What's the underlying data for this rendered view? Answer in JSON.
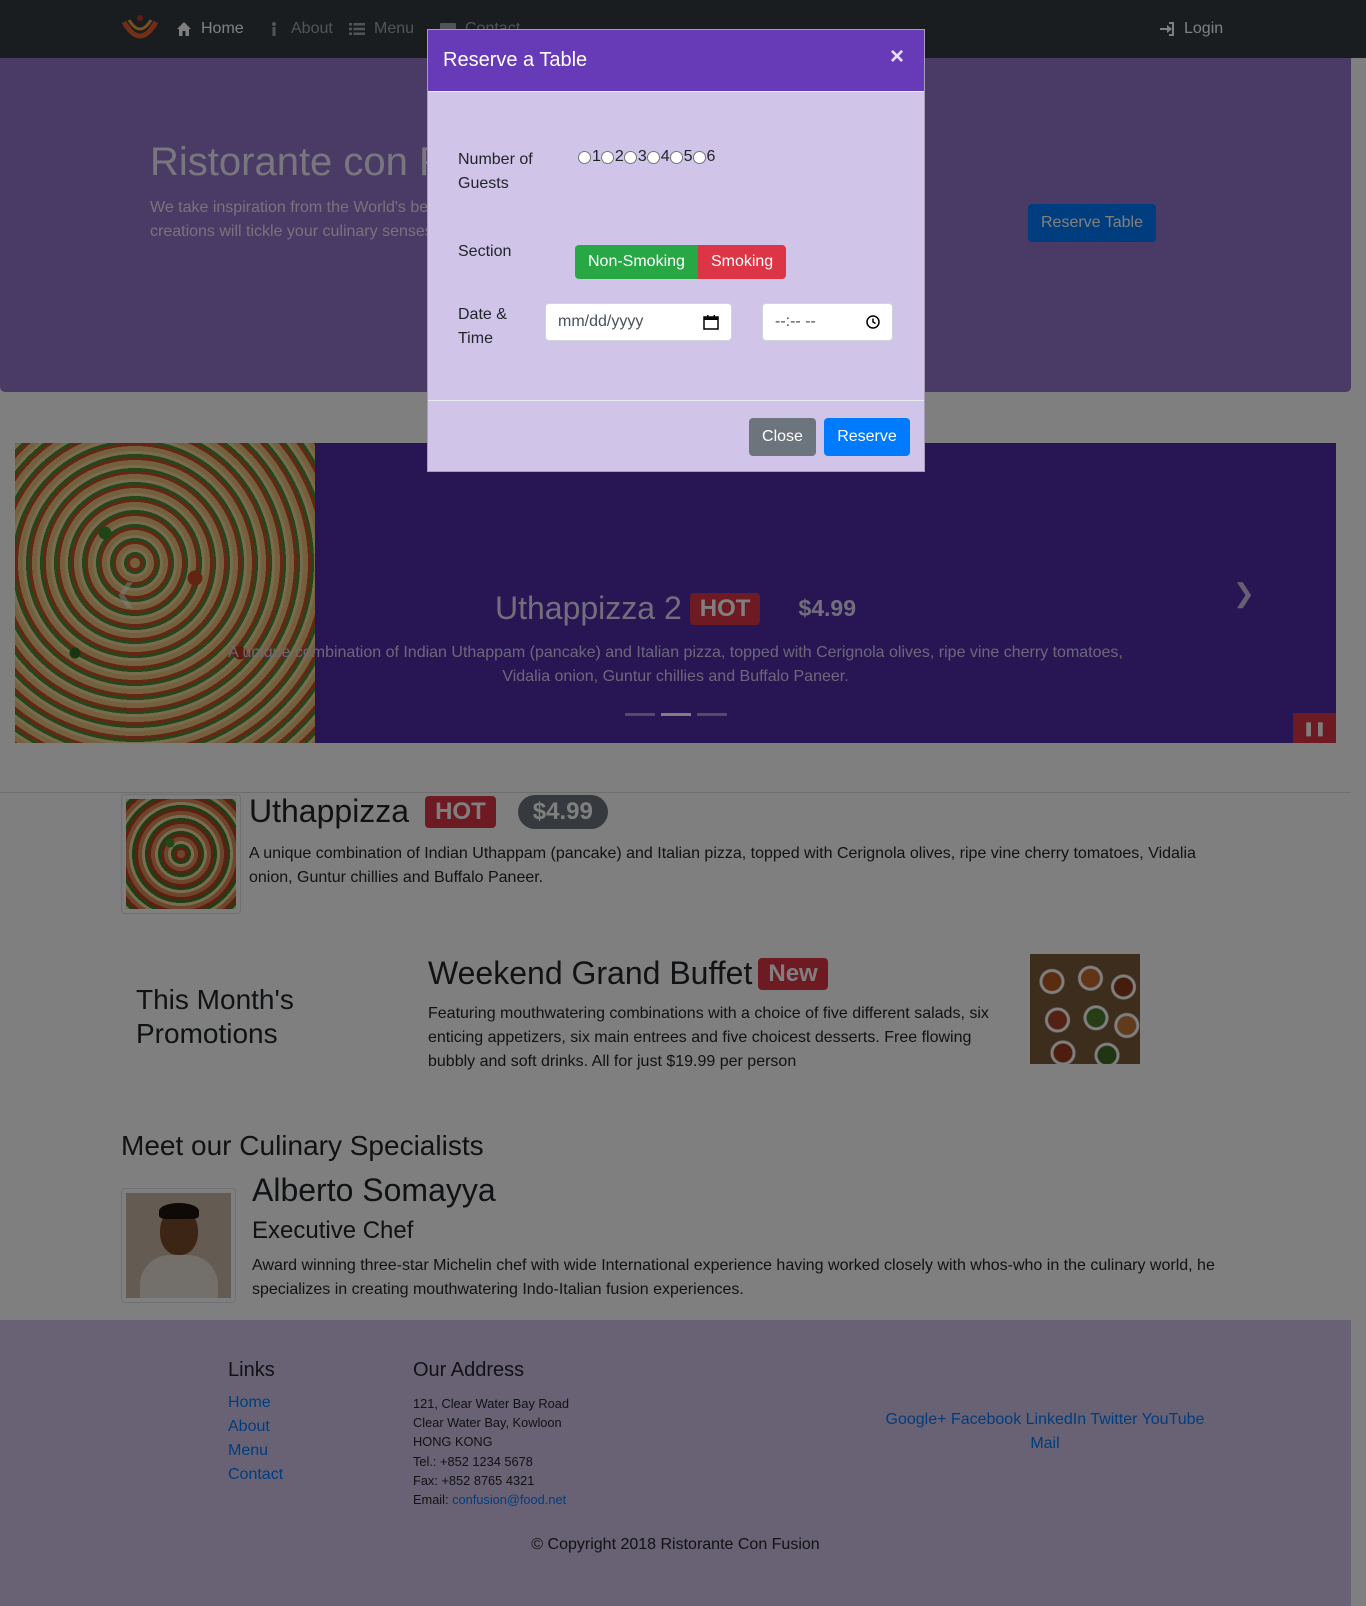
{
  "navbar": {
    "logo_name": "logo",
    "items": [
      {
        "label": "Home",
        "icon": "home-icon",
        "active": true
      },
      {
        "label": "About",
        "icon": "info-icon",
        "active": false
      },
      {
        "label": "Menu",
        "icon": "list-icon",
        "active": false
      },
      {
        "label": "Contact",
        "icon": "address-card-icon",
        "active": false
      }
    ],
    "login_label": "Login",
    "login_icon": "sign-in-icon"
  },
  "jumbotron": {
    "title": "Ristorante con Fusion",
    "text": "We take inspiration from the World's best cuisines, and create a unique fusion experience. Our lipsmacking creations will tickle your culinary senses!",
    "reserve_label": "Reserve Table"
  },
  "carousel": {
    "title": "Uthappizza 2",
    "badge": "HOT",
    "price": "$4.99",
    "description": "A unique combination of Indian Uthappam (pancake) and Italian pizza, topped with Cerignola olives, ripe vine cherry tomatoes, Vidalia onion, Guntur chillies and Buffalo Paneer.",
    "indicator_count": 3,
    "active_indicator": 2
  },
  "featured_dish": {
    "name": "Uthappizza",
    "badge": "HOT",
    "price": "$4.99",
    "description": "A unique combination of Indian Uthappam (pancake) and Italian pizza, topped with Cerignola olives, ripe vine cherry tomatoes, Vidalia onion, Guntur chillies and Buffalo Paneer."
  },
  "promotions": {
    "heading": "This Month's Promotions",
    "title": "Weekend Grand Buffet",
    "badge": "New",
    "description": "Featuring mouthwatering combinations with a choice of five different salads, six enticing appetizers, six main entrees and five choicest desserts. Free flowing bubbly and soft drinks. All for just $19.99 per person"
  },
  "specialists": {
    "heading": "Meet our Culinary Specialists",
    "name": "Alberto Somayya",
    "role": "Executive Chef",
    "description": "Award winning three-star Michelin chef with wide International experience having worked closely with whos-who in the culinary world, he specializes in creating mouthwatering Indo-Italian fusion experiences."
  },
  "footer": {
    "links_heading": "Links",
    "links": [
      "Home",
      "About",
      "Menu",
      "Contact"
    ],
    "address_heading": "Our Address",
    "address_lines": [
      "121, Clear Water Bay Road",
      "Clear Water Bay, Kowloon",
      "HONG KONG",
      "Tel.: +852 1234 5678",
      "Fax: +852 8765 4321"
    ],
    "email_label": "Email: ",
    "email": "confusion@food.net",
    "social": [
      "Google+",
      "Facebook",
      "LinkedIn",
      "Twitter",
      "YouTube",
      "Mail"
    ],
    "copyright": "© Copyright 2018 Ristorante Con Fusion"
  },
  "modal": {
    "title": "Reserve a Table",
    "close_symbol": "×",
    "guests_label_1": "Number of",
    "guests_label_2": "Guests",
    "guest_options": [
      "1",
      "2",
      "3",
      "4",
      "5",
      "6"
    ],
    "section_label": "Section",
    "non_smoking_label": "Non-Smoking",
    "smoking_label": "Smoking",
    "datetime_label_1": "Date &",
    "datetime_label_2": "Time",
    "date_placeholder": "mm/dd/yyyy",
    "time_placeholder": "--:-- --",
    "close_label": "Close",
    "reserve_label": "Reserve"
  },
  "colors": {
    "primary_dark": "#512da8",
    "primary": "#673ab7",
    "light": "#d1c4e9",
    "jumbotron": "#9575cd",
    "navbar": "#343a40",
    "danger": "#dc3545",
    "success": "#28a745",
    "link": "#007bff"
  }
}
